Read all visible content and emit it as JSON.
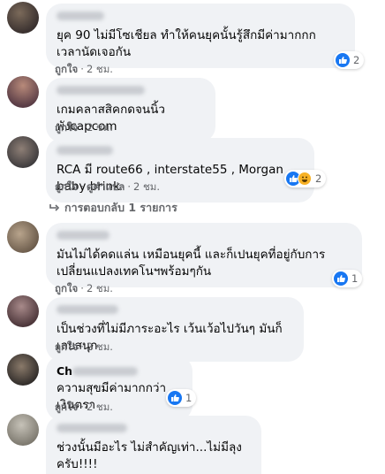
{
  "ui": {
    "like_label": "ถูกใจ",
    "reply_translate": "ดูคำแปล",
    "dot": "·"
  },
  "comments": [
    {
      "text": "ยุค 90 ไม่มีโซเชียล ทำให้คนยุคนั้นรู้สึกมีค่ามากกก เวลานัดเจอกัน",
      "time": "2 ชม.",
      "reaction_count": "2"
    },
    {
      "text": "เกมคลาสสิคกดจนนิ้วพังcapcom",
      "time": "2 ชม."
    },
    {
      "text": "RCA มี route66 , interstate55 , Morgan , baby brink",
      "time": "2 ชม.",
      "reaction_count": "2"
    },
    {
      "text": "มันไม่ได้คดแล่น เหมือนยุคนี้ และก็เปนยุคที่อยู่กับการเปลี่ยนแปลงเทคโนฯพร้อมๆกัน",
      "time": "2 ชม.",
      "reaction_count": "1"
    },
    {
      "text": "เป็นช่วงที่ไม่มีภาระอะไร เว้นเว้อไปวันๆ มันก็เลยสนุก",
      "time": "2 ชม."
    },
    {
      "name_prefix": "Ch",
      "text": "ความสุขมีค่ามากกว่าเงินตรา",
      "time": "2 ชม.",
      "reaction_count": "1"
    },
    {
      "text": "ช่วงนั้นมีอะไร ไม่สำคัญเท่า...ไม่มีลุงครับ!!!!",
      "time": "2 ชม."
    }
  ],
  "replies_link": "การตอบกลับ 1 รายการ",
  "colors": {
    "bubble": "#f0f2f5",
    "meta": "#65676b",
    "like_blue": "#1877f2"
  }
}
